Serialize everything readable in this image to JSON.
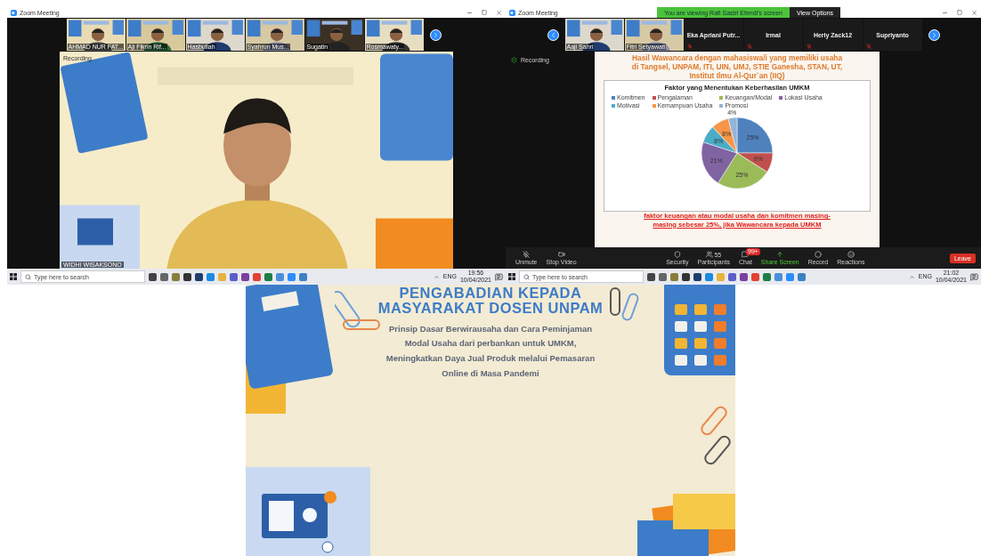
{
  "left_meeting": {
    "window_title": "Zoom Meeting",
    "thumbnails": [
      {
        "name": "AHMAD NUR FAT..."
      },
      {
        "name": "Aji Fikrin Rif..."
      },
      {
        "name": "Hasbullah"
      },
      {
        "name": "Syahrun Mus..."
      },
      {
        "name": "Sugatin"
      },
      {
        "name": "Rosmawaty..."
      }
    ],
    "recording": "Recording",
    "speaker_name": "WIDHI WISAKSONO",
    "taskbar": {
      "search_placeholder": "Type here to search",
      "language": "ENG",
      "time": "19:56",
      "date": "10/04/2021"
    }
  },
  "right_meeting": {
    "window_title": "Zoom Meeting",
    "banner": "You are viewing Rafi Sastri Efendi's screen",
    "view_options": "View Options",
    "thumbnails": [
      {
        "kind": "video",
        "name": "Aaji Sahri"
      },
      {
        "kind": "video",
        "name": "Fitri Setyawati"
      },
      {
        "kind": "name",
        "name": "Eka Apriani Putr..."
      },
      {
        "kind": "name",
        "name": "Irmal"
      },
      {
        "kind": "name",
        "name": "Herly Zack12"
      },
      {
        "kind": "name",
        "name": "Supriyanto"
      }
    ],
    "recording": "Recording",
    "slide": {
      "title_lines": [
        "Hasil Wawancara dengan mahasiswa/i yang memiliki usaha",
        "di Tangsel, UNPAM, ITI, UIN, UMJ, STIE Ganesha, STAN, UT,",
        "Institut Ilmu Al-Qur`an (IIQ)"
      ],
      "chart_data": {
        "type": "pie",
        "title": "Faktor yang Menentukan Keberhasilan UMKM",
        "categories": [
          "Komitmen",
          "Pengalaman",
          "Keuangan/Modal",
          "Lokasi Usaha",
          "Motivasi",
          "Kemampuan Usaha",
          "Promosi"
        ],
        "values": [
          25,
          9,
          25,
          21,
          8,
          8,
          4
        ],
        "colors": [
          "#4f81bd",
          "#c0504d",
          "#9bbb59",
          "#8064a2",
          "#4bacc6",
          "#f79646",
          "#95b3d7"
        ],
        "value_labels": [
          "25%",
          "9%",
          "25%",
          "21%",
          "8%",
          "8%",
          "4%"
        ]
      },
      "caption_lines": [
        "faktor keuangan atau modal usaha dan komitmen masing-",
        "masing sebesar 25%, jika Wawancara kepada UMKM"
      ]
    },
    "controls": [
      {
        "kind": "unmute",
        "label": "Unmute"
      },
      {
        "kind": "video",
        "label": "Stop Video"
      },
      {
        "kind": "security",
        "label": "Security"
      },
      {
        "kind": "participants",
        "label": "Participants",
        "count": "55"
      },
      {
        "kind": "chat",
        "label": "Chat",
        "badge": "99+"
      },
      {
        "kind": "share",
        "label": "Share Screen"
      },
      {
        "kind": "record",
        "label": "Record"
      },
      {
        "kind": "reactions",
        "label": "Reactions"
      }
    ],
    "leave": "Leave",
    "taskbar": {
      "search_placeholder": "Type here to search",
      "language": "ENG",
      "time": "21:02",
      "date": "10/04/2021"
    }
  },
  "slide": {
    "title_lines": [
      "PENGABADIAN KEPADA",
      "MASYARAKAT DOSEN UNPAM"
    ],
    "subtitle_lines": [
      "Prinsip Dasar Berwirausaha dan Cara Peminjaman",
      "Modal Usaha dari perbankan untuk UMKM,",
      "Meningkatkan Daya Jual Produk melalui Pemasaran",
      "Online di Masa Pandemi"
    ]
  }
}
